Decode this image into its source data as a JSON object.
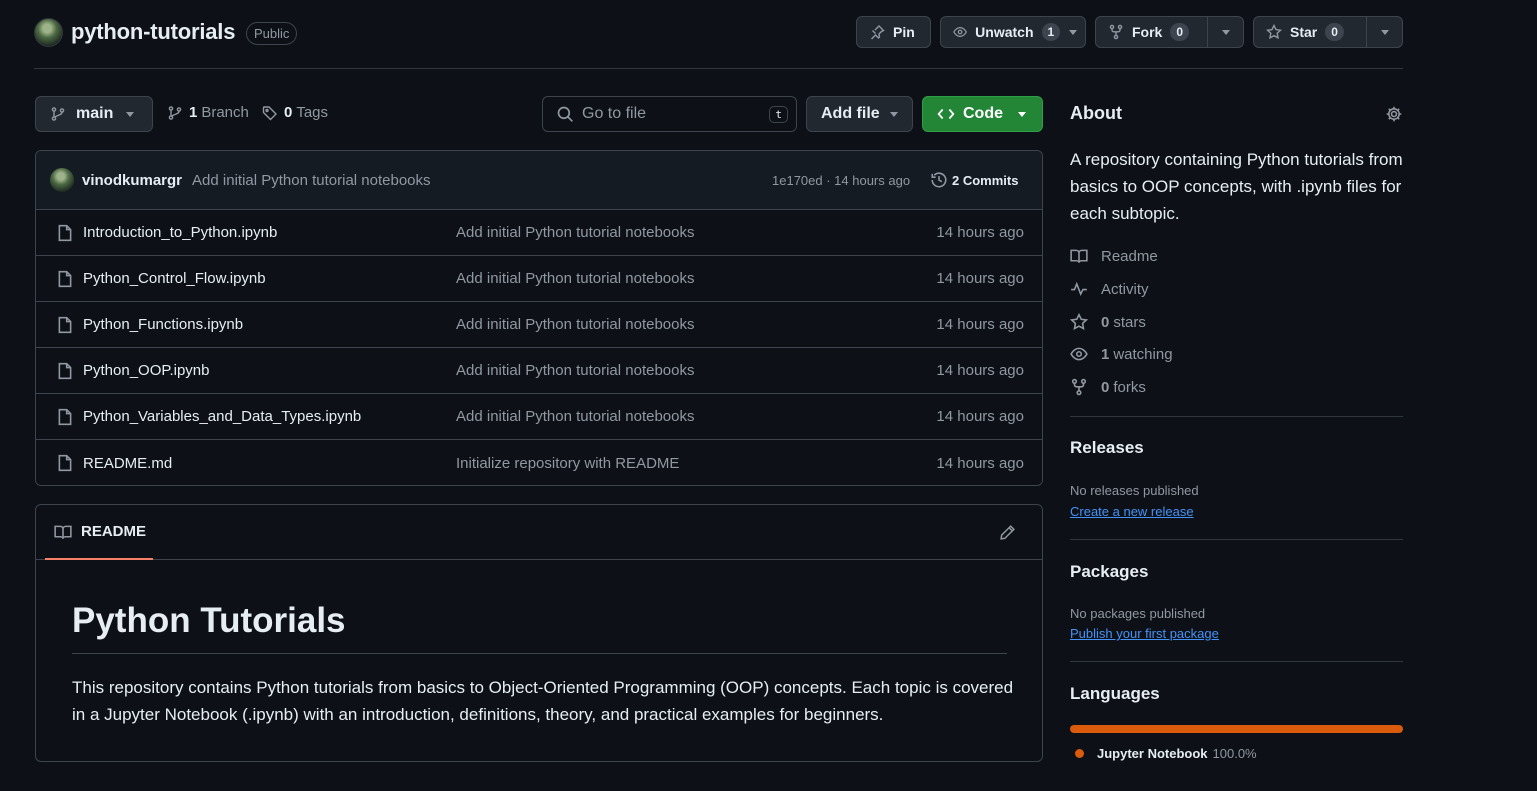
{
  "repo": {
    "name": "python-tutorials",
    "visibility": "Public"
  },
  "actions": {
    "pin_label": "Pin",
    "unwatch_label": "Unwatch",
    "unwatch_count": "1",
    "fork_label": "Fork",
    "fork_count": "0",
    "star_label": "Star",
    "star_count": "0"
  },
  "toolbar": {
    "branch": "main",
    "branch_count": "1",
    "branch_label": "Branch",
    "tag_count": "0",
    "tag_label": "Tags",
    "search_placeholder": "Go to file",
    "search_shortcut": "t",
    "add_file_label": "Add file",
    "code_label": "Code"
  },
  "latest_commit": {
    "author": "vinodkumargr",
    "message": "Add initial Python tutorial notebooks",
    "meta": "1e170ed · 14 hours ago",
    "commits_label": "2 Commits"
  },
  "files": [
    {
      "name": "Introduction_to_Python.ipynb",
      "message": "Add initial Python tutorial notebooks",
      "date": "14 hours ago"
    },
    {
      "name": "Python_Control_Flow.ipynb",
      "message": "Add initial Python tutorial notebooks",
      "date": "14 hours ago"
    },
    {
      "name": "Python_Functions.ipynb",
      "message": "Add initial Python tutorial notebooks",
      "date": "14 hours ago"
    },
    {
      "name": "Python_OOP.ipynb",
      "message": "Add initial Python tutorial notebooks",
      "date": "14 hours ago"
    },
    {
      "name": "Python_Variables_and_Data_Types.ipynb",
      "message": "Add initial Python tutorial notebooks",
      "date": "14 hours ago"
    },
    {
      "name": "README.md",
      "message": "Initialize repository with README",
      "date": "14 hours ago"
    }
  ],
  "readme": {
    "tab_label": "README",
    "title": "Python Tutorials",
    "body": "This repository contains Python tutorials from basics to Object-Oriented Programming (OOP) concepts. Each topic is covered in a Jupyter Notebook (.ipynb) with an introduction, definitions, theory, and practical examples for beginners."
  },
  "about": {
    "title": "About",
    "description": "A repository containing Python tutorials from basics to OOP concepts, with .ipynb files for each subtopic.",
    "readme_label": "Readme",
    "activity_label": "Activity",
    "stars_count": "0",
    "stars_label": "stars",
    "watching_count": "1",
    "watching_label": "watching",
    "forks_count": "0",
    "forks_label": "forks"
  },
  "releases": {
    "title": "Releases",
    "status": "No releases published",
    "link": "Create a new release"
  },
  "packages": {
    "title": "Packages",
    "status": "No packages published",
    "link": "Publish your first package"
  },
  "languages": {
    "title": "Languages",
    "items": [
      {
        "name": "Jupyter Notebook",
        "percent": "100.0%",
        "share": 1.0,
        "color": "#DA5B0B"
      }
    ]
  },
  "colors": {
    "background": "#0d1117",
    "accent_green": "#238636",
    "link_blue": "#4493f8",
    "tab_underline": "#f78166"
  }
}
